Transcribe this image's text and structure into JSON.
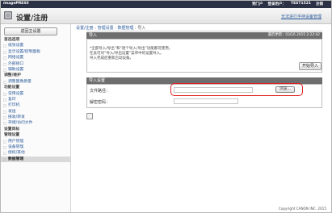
{
  "topbar": {
    "brand": "imagePRESS",
    "links": [
      "到门户",
      "登录用户：",
      "TEST1521",
      "注销"
    ]
  },
  "titlebar": {
    "title": "设置/注册",
    "right_link": "无法进行手持设备管理"
  },
  "sidebar": {
    "button": "返回主设置",
    "sections": [
      {
        "title": "首选选项",
        "items": [
          "纸张设置",
          "显示设置/控制面板",
          "网络设置",
          "外部接口",
          "辅助设置"
        ]
      },
      {
        "title": "调整/维护",
        "items": [
          "调整图像质量"
        ]
      },
      {
        "title": "功能设置",
        "items": [
          "常用设置",
          "复印",
          "打印机",
          "发送",
          "接收/转发",
          "存储/访问文件"
        ]
      },
      {
        "title": "设置目标",
        "items": []
      },
      {
        "title": "管理设置",
        "items": [
          "用户管理",
          "设备管理",
          "授权/其他",
          "数据管理"
        ]
      }
    ],
    "active_item": "数据管理"
  },
  "breadcrumb": [
    "设置/注册",
    "管理设置",
    "数据管理",
    "导入"
  ],
  "panel1": {
    "title": "导入",
    "right_text": "最后更新：03/16 2015 2:22:42",
    "description": [
      "*全部导入/导出”和“逐个导入/导出”功能都可使用。",
      "在此可对“导入/导出设置”菜单中的设置导入。",
      "导入完成后重新启动设备。"
    ],
    "import_button": "开始导入"
  },
  "panel2": {
    "title": "导入设置",
    "file_label": "文件路径：",
    "browse_button": "浏览...",
    "password_label": "解密密码："
  },
  "copyright": "Copyright CANON INC. 2015"
}
